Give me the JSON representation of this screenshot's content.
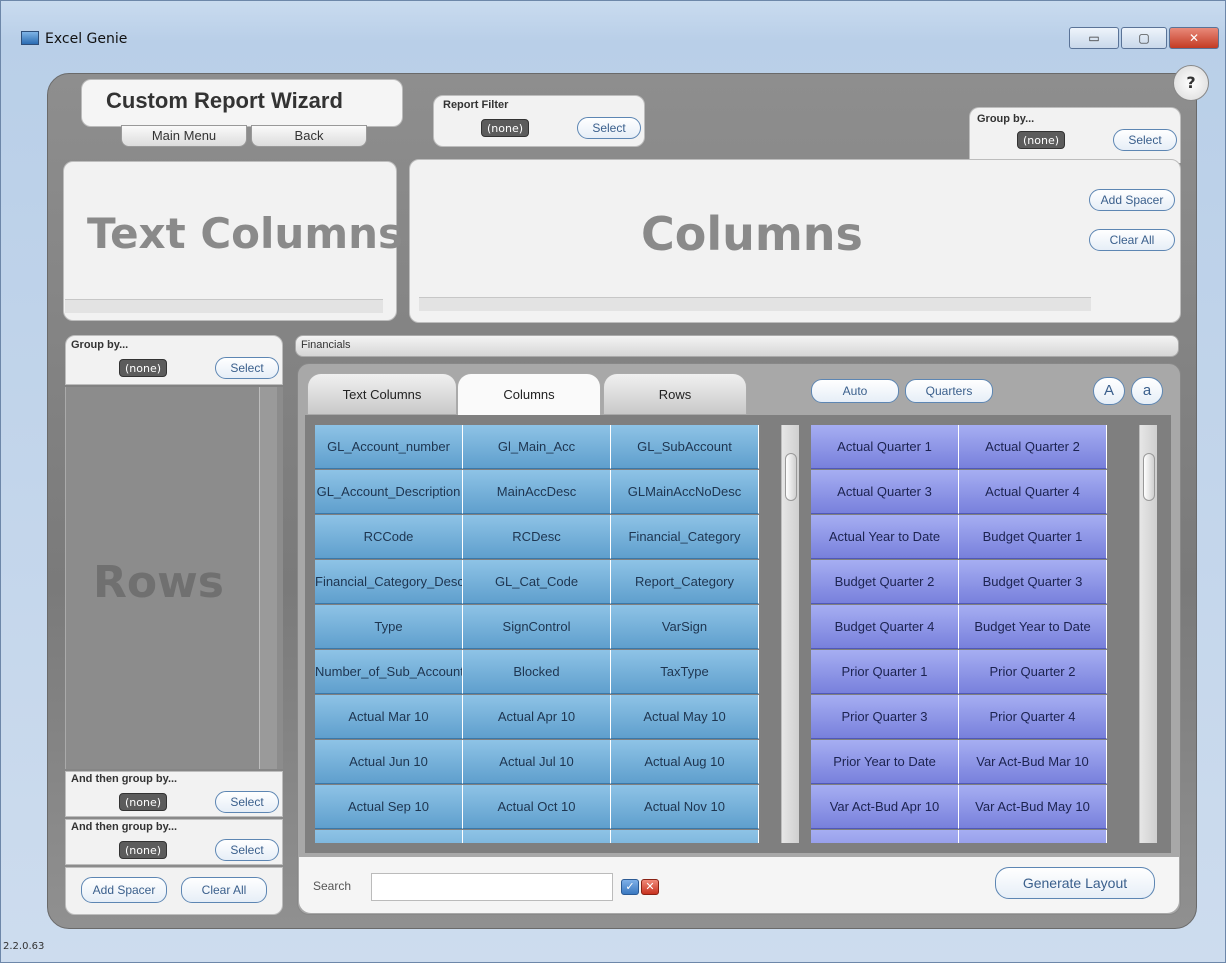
{
  "window": {
    "title": "Excel Genie",
    "min_label": "▭",
    "max_label": "▢",
    "close_label": "✕",
    "help_label": "?",
    "version": "2.2.0.63"
  },
  "header": {
    "title": "Custom Report Wizard",
    "main_menu_label": "Main Menu",
    "back_label": "Back"
  },
  "report_filter": {
    "label": "Report Filter",
    "value": "(none)",
    "select_label": "Select"
  },
  "top_group_by": {
    "label": "Group by...",
    "value": "(none)",
    "select_label": "Select"
  },
  "text_columns_panel": {
    "title": "Text Columns"
  },
  "columns_panel": {
    "title": "Columns",
    "add_spacer_label": "Add Spacer",
    "clear_all_label": "Clear All"
  },
  "left_panel": {
    "group_by_label": "Group by...",
    "group_by_value": "(none)",
    "select_label": "Select",
    "rows_title": "Rows",
    "then_group_1_label": "And then group by...",
    "then_group_1_value": "(none)",
    "then_group_2_label": "And then group by...",
    "then_group_2_value": "(none)",
    "add_spacer_label": "Add Spacer",
    "clear_all_label": "Clear All"
  },
  "financials": {
    "label": "Financials",
    "tabs": [
      "Text Columns",
      "Columns",
      "Rows"
    ],
    "active_tab": "Columns",
    "auto_label": "Auto",
    "quarters_label": "Quarters",
    "upper_label": "A",
    "lower_label": "a",
    "search_label": "Search",
    "search_value": "",
    "generate_label": "Generate Layout"
  },
  "field_grid": [
    [
      "GL_Account_number",
      "Gl_Main_Acc",
      "GL_SubAccount"
    ],
    [
      "GL_Account_Description",
      "MainAccDesc",
      "GLMainAccNoDesc"
    ],
    [
      "RCCode",
      "RCDesc",
      "Financial_Category"
    ],
    [
      "Financial_Category_Description",
      "GL_Cat_Code",
      "Report_Category"
    ],
    [
      "Type",
      "SignControl",
      "VarSign"
    ],
    [
      "Number_of_Sub_Accounts",
      "Blocked",
      "TaxType"
    ],
    [
      "Actual Mar 10",
      "Actual Apr 10",
      "Actual May 10"
    ],
    [
      "Actual Jun 10",
      "Actual Jul 10",
      "Actual Aug 10"
    ],
    [
      "Actual Sep 10",
      "Actual Oct 10",
      "Actual Nov 10"
    ]
  ],
  "period_grid": [
    [
      "Actual Quarter 1",
      "Actual Quarter 2"
    ],
    [
      "Actual Quarter 3",
      "Actual Quarter 4"
    ],
    [
      "Actual Year to Date",
      "Budget Quarter 1"
    ],
    [
      "Budget Quarter 2",
      "Budget Quarter 3"
    ],
    [
      "Budget Quarter 4",
      "Budget Year to Date"
    ],
    [
      "Prior Quarter 1",
      "Prior Quarter 2"
    ],
    [
      "Prior Quarter 3",
      "Prior Quarter 4"
    ],
    [
      "Prior Year to Date",
      "Var Act-Bud Mar 10"
    ],
    [
      "Var Act-Bud Apr 10",
      "Var Act-Bud May 10"
    ]
  ],
  "colors": {
    "field_cell": "#6fa9d4",
    "period_cell": "#8a91e6",
    "accent": "#3a5f8c"
  }
}
